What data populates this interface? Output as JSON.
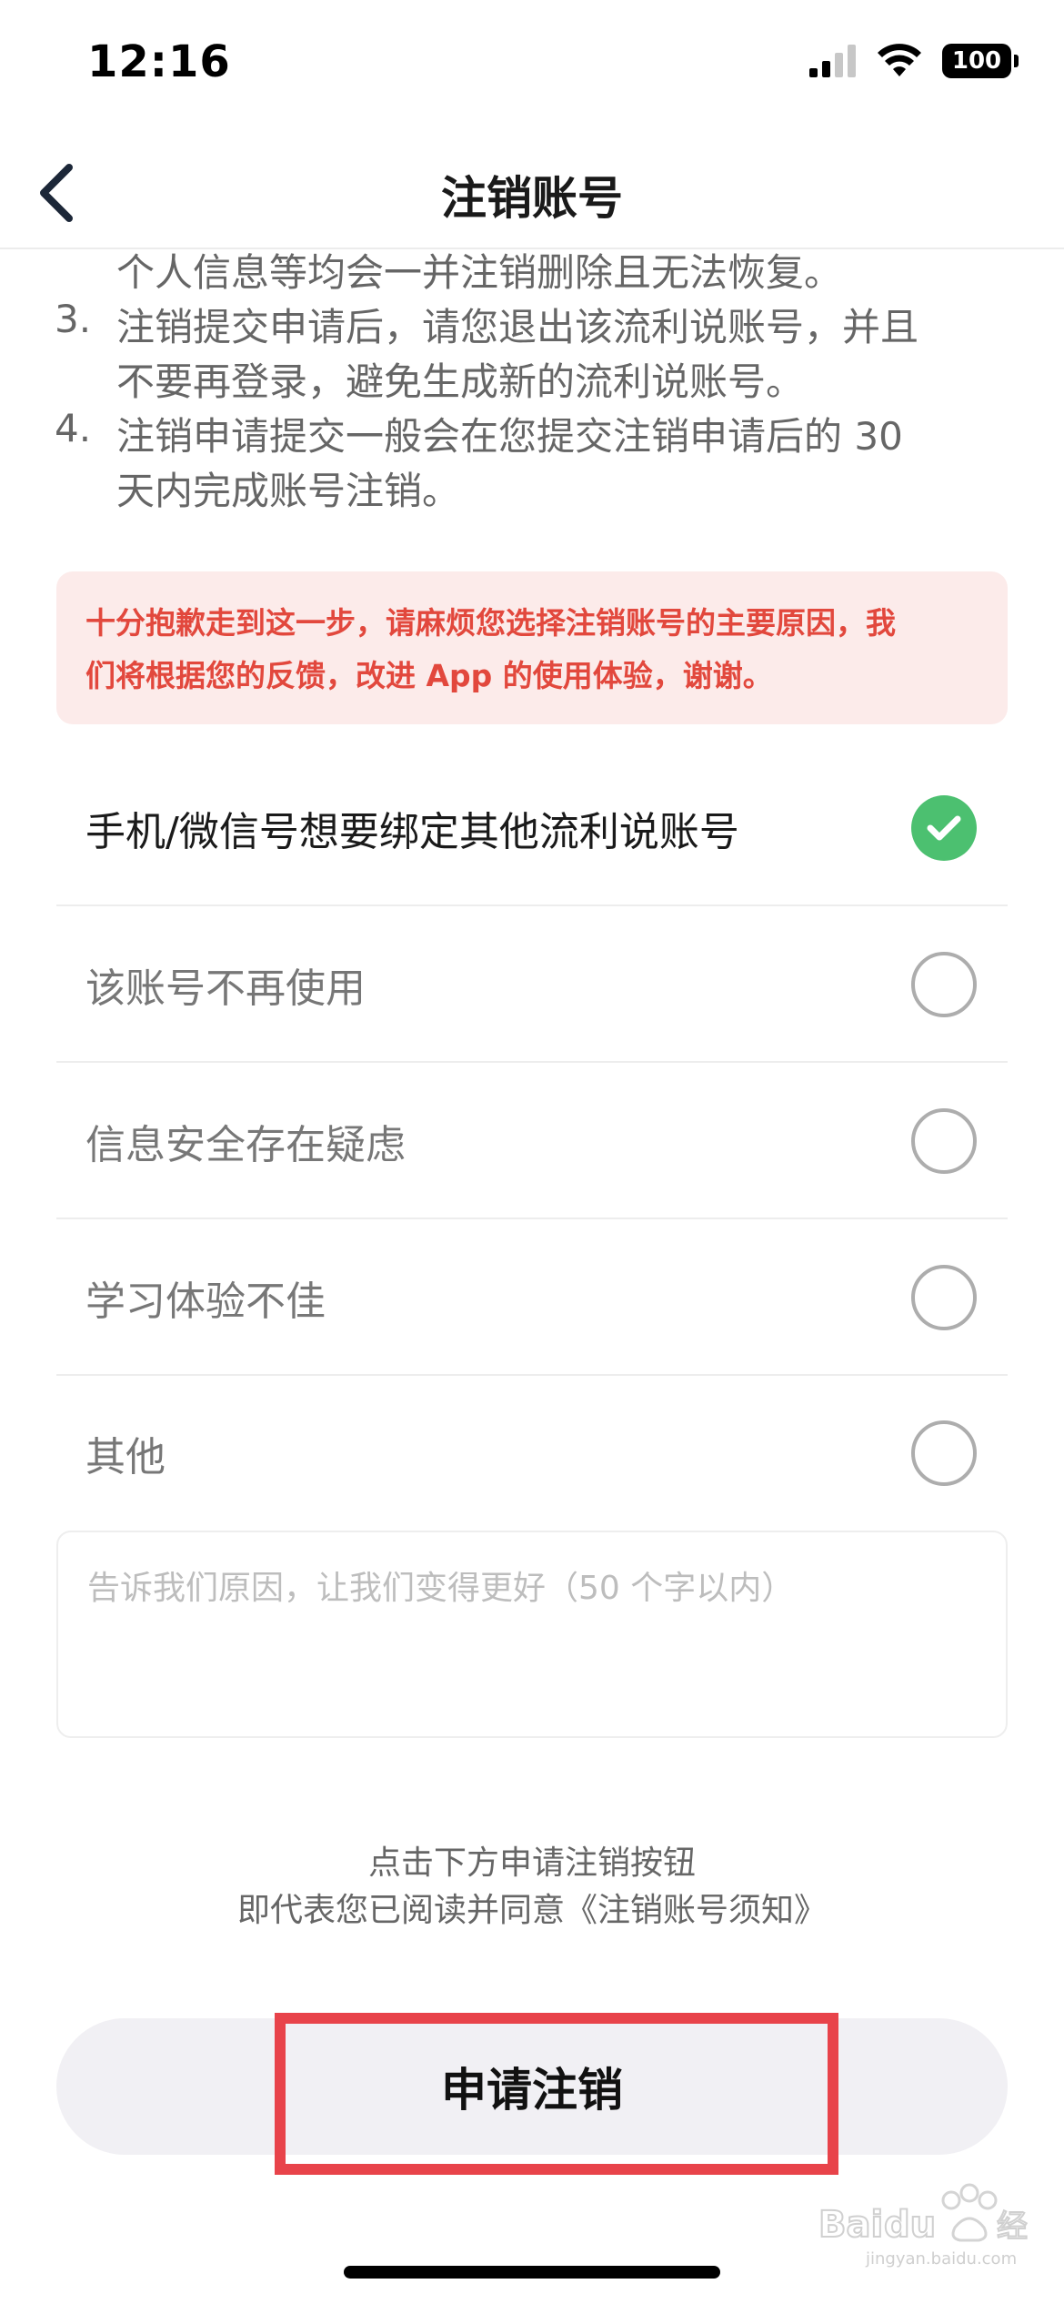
{
  "status_bar": {
    "time": "12:16",
    "battery": "100"
  },
  "nav": {
    "title": "注销账号"
  },
  "notice": {
    "item2_tail": "个人信息等均会一并注销删除且无法恢复。",
    "item3_num": "3.",
    "item3_line1": "注销提交申请后，请您退出该流利说账号，并且",
    "item3_line2": "不要再登录，避免生成新的流利说账号。",
    "item4_num": "4.",
    "item4_line1": "注销申请提交一般会在您提交注销申请后的 30",
    "item4_line2": "天内完成账号注销。"
  },
  "alert": {
    "line1": "十分抱歉走到这一步，请麻烦您选择注销账号的主要原因，我",
    "line2": "们将根据您的反馈，改进 App 的使用体验，谢谢。"
  },
  "options": [
    {
      "label": "手机/微信号想要绑定其他流利说账号",
      "selected": true
    },
    {
      "label": "该账号不再使用",
      "selected": false
    },
    {
      "label": "信息安全存在疑虑",
      "selected": false
    },
    {
      "label": "学习体验不佳",
      "selected": false
    },
    {
      "label": "其他",
      "selected": false
    }
  ],
  "reason_input": {
    "placeholder": "告诉我们原因，让我们变得更好（50 个字以内）",
    "value": ""
  },
  "agreement": {
    "line1": "点击下方申请注销按钮",
    "line2_prefix": "即代表您已阅读并同意",
    "line2_link": "《注销账号须知》"
  },
  "submit": {
    "label": "申请注销"
  },
  "watermark": {
    "text": "Baidu 经验",
    "subtext": "jingyan.baidu.com"
  },
  "colors": {
    "accent_red": "#e2483d",
    "check_green": "#4cc070",
    "highlight": "#e8434a"
  },
  "icons": {
    "back": "chevron-left-icon",
    "check": "check-icon",
    "signal": "signal-icon",
    "wifi": "wifi-icon"
  }
}
